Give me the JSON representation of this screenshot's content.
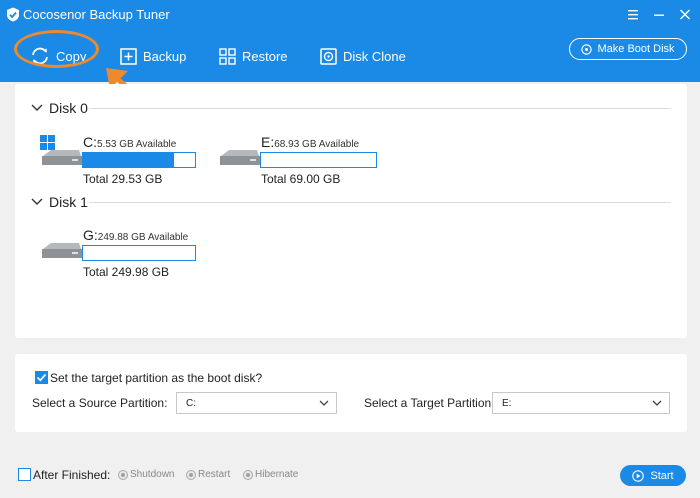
{
  "app": {
    "title": "Cocosenor Backup Tuner"
  },
  "toolbar": {
    "copy_label": "Copy",
    "backup_label": "Backup",
    "restore_label": "Restore",
    "disk_clone_label": "Disk Clone",
    "make_boot_disk_label": "Make Boot Disk"
  },
  "disks": [
    {
      "name": "Disk 0",
      "partitions": [
        {
          "letter": "C:",
          "available": "5.53 GB Available",
          "total": "Total 29.53 GB",
          "usage_fraction": 0.81,
          "windows": true
        },
        {
          "letter": "E:",
          "available": "68.93 GB Available",
          "total": "Total 69.00 GB",
          "usage_fraction": 0.0,
          "windows": false
        }
      ]
    },
    {
      "name": "Disk 1",
      "partitions": [
        {
          "letter": "G:",
          "available": "249.88 GB Available",
          "total": "Total 249.98 GB",
          "usage_fraction": 0.0,
          "windows": false
        }
      ]
    }
  ],
  "options": {
    "boot_checkbox_label": "Set the target partition as the boot disk?",
    "boot_checked": true,
    "source_label": "Select a Source Partition:",
    "source_value": "C:",
    "target_label": "Select a Target Partition:",
    "target_value": "E:"
  },
  "footer": {
    "after_finished_label": "After Finished:",
    "after_finished_checked": false,
    "shutdown_label": "Shutdown",
    "restart_label": "Restart",
    "hibernate_label": "Hibernate",
    "start_label": "Start"
  },
  "colors": {
    "accent": "#1a8ae6",
    "highlight": "#ec8a2c"
  }
}
